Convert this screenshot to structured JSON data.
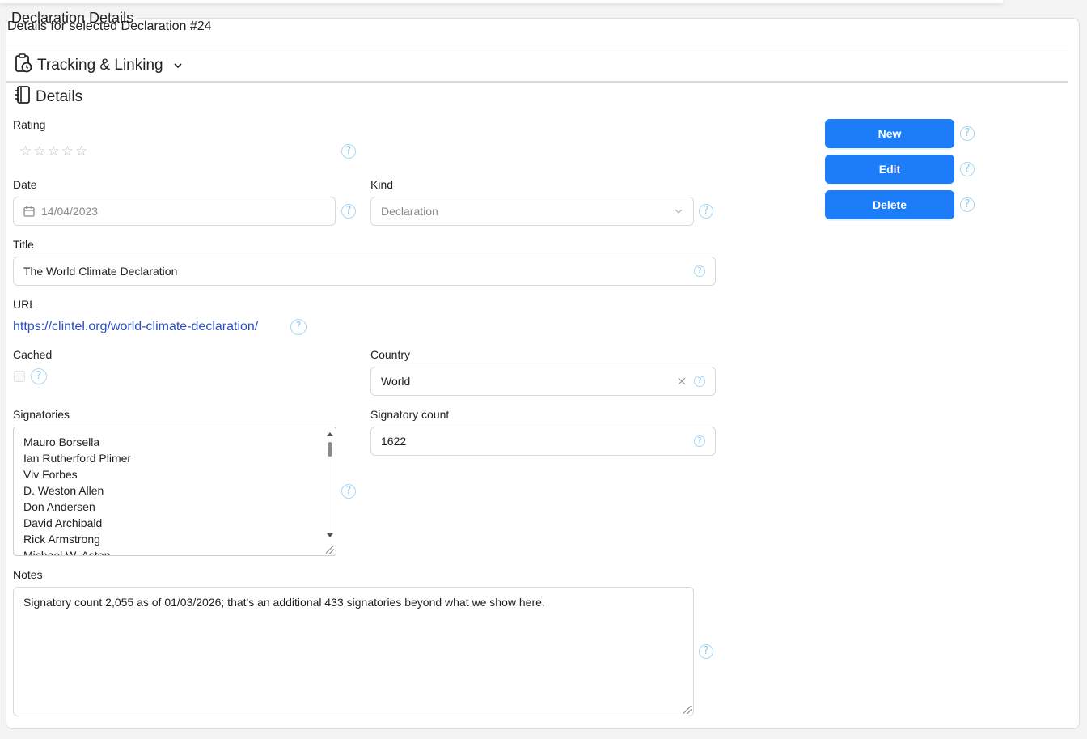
{
  "panel": {
    "legend": "Declaration Details",
    "subtitle": "Details for selected Declaration #24"
  },
  "sections": {
    "tracking": "Tracking & Linking",
    "details": "Details"
  },
  "fields": {
    "rating": {
      "label": "Rating",
      "value": 0,
      "max": 5
    },
    "date": {
      "label": "Date",
      "value": "14/04/2023"
    },
    "kind": {
      "label": "Kind",
      "value": "Declaration"
    },
    "title": {
      "label": "Title",
      "value": "The World Climate Declaration"
    },
    "url": {
      "label": "URL",
      "value": "https://clintel.org/world-climate-declaration/"
    },
    "cached": {
      "label": "Cached",
      "checked": false
    },
    "country": {
      "label": "Country",
      "value": "World"
    },
    "signatories": {
      "label": "Signatories",
      "items": [
        "Mauro Borsella",
        "Ian Rutherford Plimer",
        "Viv Forbes",
        "D. Weston Allen",
        "Don Andersen",
        "David Archibald",
        "Rick Armstrong",
        "Michael W. Aston"
      ]
    },
    "signatory_count": {
      "label": "Signatory count",
      "value": "1622"
    },
    "notes": {
      "label": "Notes",
      "value": "Signatory count 2,055 as of 01/03/2026; that's an additional 433 signatories beyond what we show here."
    }
  },
  "buttons": {
    "new": "New",
    "edit": "Edit",
    "delete": "Delete"
  },
  "icons": {
    "help": "?",
    "tracking": "clipboard-clock-icon",
    "details": "notebook-icon",
    "calendar": "calendar-icon",
    "chevron": "chevron-down-icon",
    "clear": "close-icon",
    "star": "star-outline-icon"
  },
  "colors": {
    "primary": "#1d7cf7",
    "link": "#2a4ec4",
    "help": "#a8d8f5"
  }
}
